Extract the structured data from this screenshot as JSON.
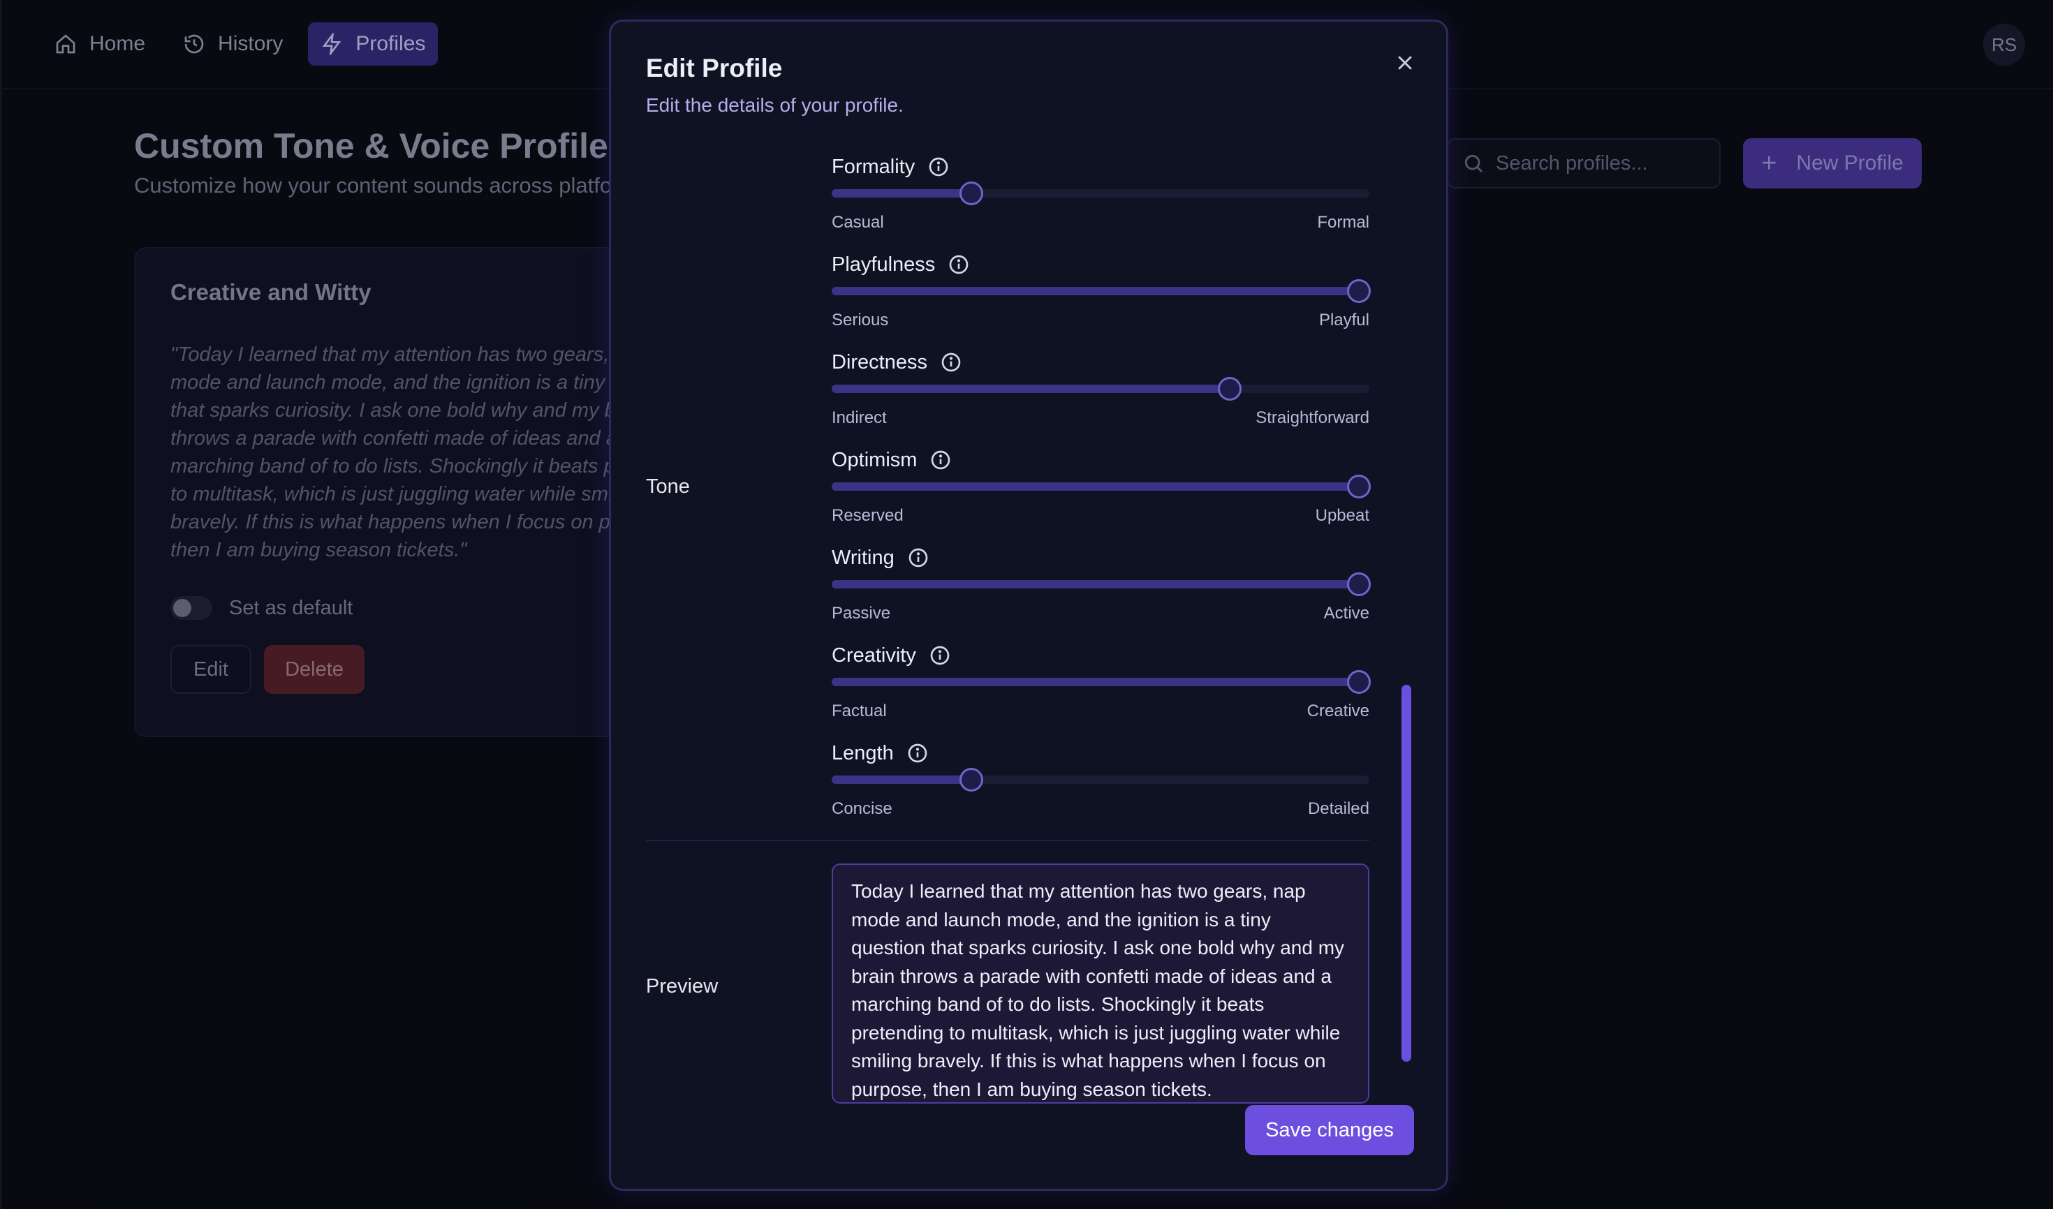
{
  "nav": {
    "items": [
      {
        "label": "Home",
        "icon": "home-icon"
      },
      {
        "label": "History",
        "icon": "history-icon"
      },
      {
        "label": "Profiles",
        "icon": "bolt-icon",
        "active": true
      }
    ],
    "avatar_initials": "RS"
  },
  "page": {
    "title": "Custom Tone & Voice Profiles",
    "subtitle": "Customize how your content sounds across platforms",
    "search_placeholder": "Search profiles...",
    "new_profile_label": "New Profile"
  },
  "card": {
    "title": "Creative and Witty",
    "quote": "\"Today I learned that my attention has two gears, nap mode and launch mode, and the ignition is a tiny question that sparks curiosity. I ask one bold why and my brain throws a parade with confetti made of ideas and a marching band of to do lists. Shockingly it beats pretending to multitask, which is just juggling water while smiling bravely. If this is what happens when I focus on purpose, then I am buying season tickets.\"",
    "default_label": "Set as default",
    "edit_label": "Edit",
    "delete_label": "Delete"
  },
  "modal": {
    "title": "Edit Profile",
    "description": "Edit the details of your profile.",
    "tone_label": "Tone",
    "sliders": [
      {
        "name": "Formality",
        "min_label": "Casual",
        "max_label": "Formal",
        "value": 0.26
      },
      {
        "name": "Playfulness",
        "min_label": "Serious",
        "max_label": "Playful",
        "value": 0.98
      },
      {
        "name": "Directness",
        "min_label": "Indirect",
        "max_label": "Straightforward",
        "value": 0.74
      },
      {
        "name": "Optimism",
        "min_label": "Reserved",
        "max_label": "Upbeat",
        "value": 0.98
      },
      {
        "name": "Writing",
        "min_label": "Passive",
        "max_label": "Active",
        "value": 0.98
      },
      {
        "name": "Creativity",
        "min_label": "Factual",
        "max_label": "Creative",
        "value": 0.98
      },
      {
        "name": "Length",
        "min_label": "Concise",
        "max_label": "Detailed",
        "value": 0.26
      }
    ],
    "preview_label": "Preview",
    "preview_text": "Today I learned that my attention has two gears, nap mode and launch mode, and the ignition is a tiny question that sparks curiosity. I ask one bold why and my brain throws a parade with confetti made of ideas and a marching band of to do lists. Shockingly it beats pretending to multitask, which is just juggling water while smiling bravely. If this is what happens when I focus on purpose, then I am buying season tickets.",
    "save_label": "Save changes"
  },
  "colors": {
    "accent": "#6c4fdf",
    "background": "#0b0d17",
    "modal_background": "#0f1222",
    "slider_fill": "#3a3487",
    "delete": "#5e2530"
  }
}
